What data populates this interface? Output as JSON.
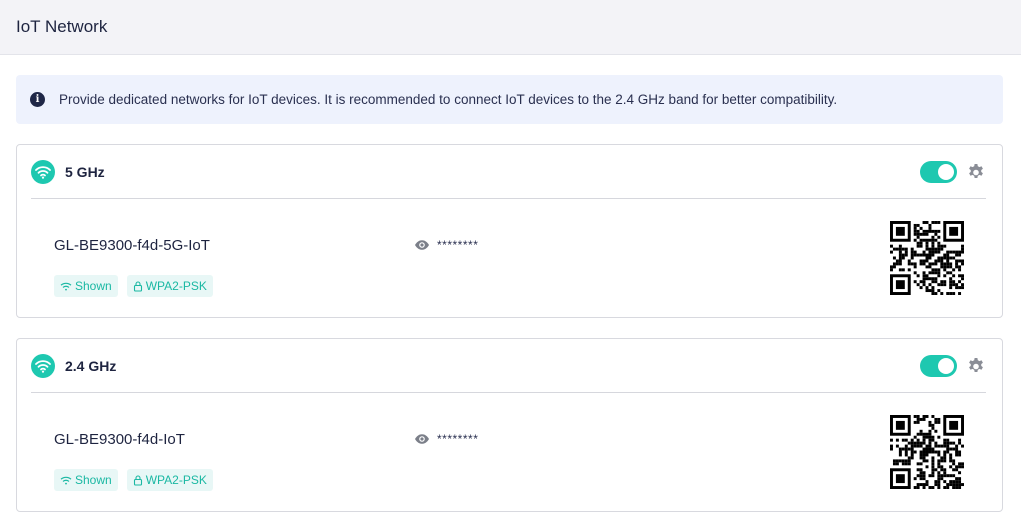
{
  "header": {
    "title": "IoT Network"
  },
  "notice": {
    "text": "Provide dedicated networks for IoT devices. It is recommended to connect IoT devices to the 2.4 GHz band for better compatibility."
  },
  "networks": [
    {
      "band": "5 GHz",
      "enabled": true,
      "ssid": "GL-BE9300-f4d-5G-IoT",
      "password_mask": "********",
      "visibility": "Shown",
      "security": "WPA2-PSK"
    },
    {
      "band": "2.4 GHz",
      "enabled": true,
      "ssid": "GL-BE9300-f4d-IoT",
      "password_mask": "********",
      "visibility": "Shown",
      "security": "WPA2-PSK"
    }
  ],
  "colors": {
    "accent": "#1ec8b0",
    "tag_bg": "#e8f7f6",
    "notice_bg": "#eef2fd",
    "header_bg": "#f3f3f7"
  },
  "icons": {
    "info": "info-icon",
    "wifi": "wifi-icon",
    "settings": "gear-icon",
    "reveal": "eye-icon",
    "broadcast": "wifi-signal-icon",
    "lock": "lock-icon",
    "qr": "qr-code-icon"
  }
}
